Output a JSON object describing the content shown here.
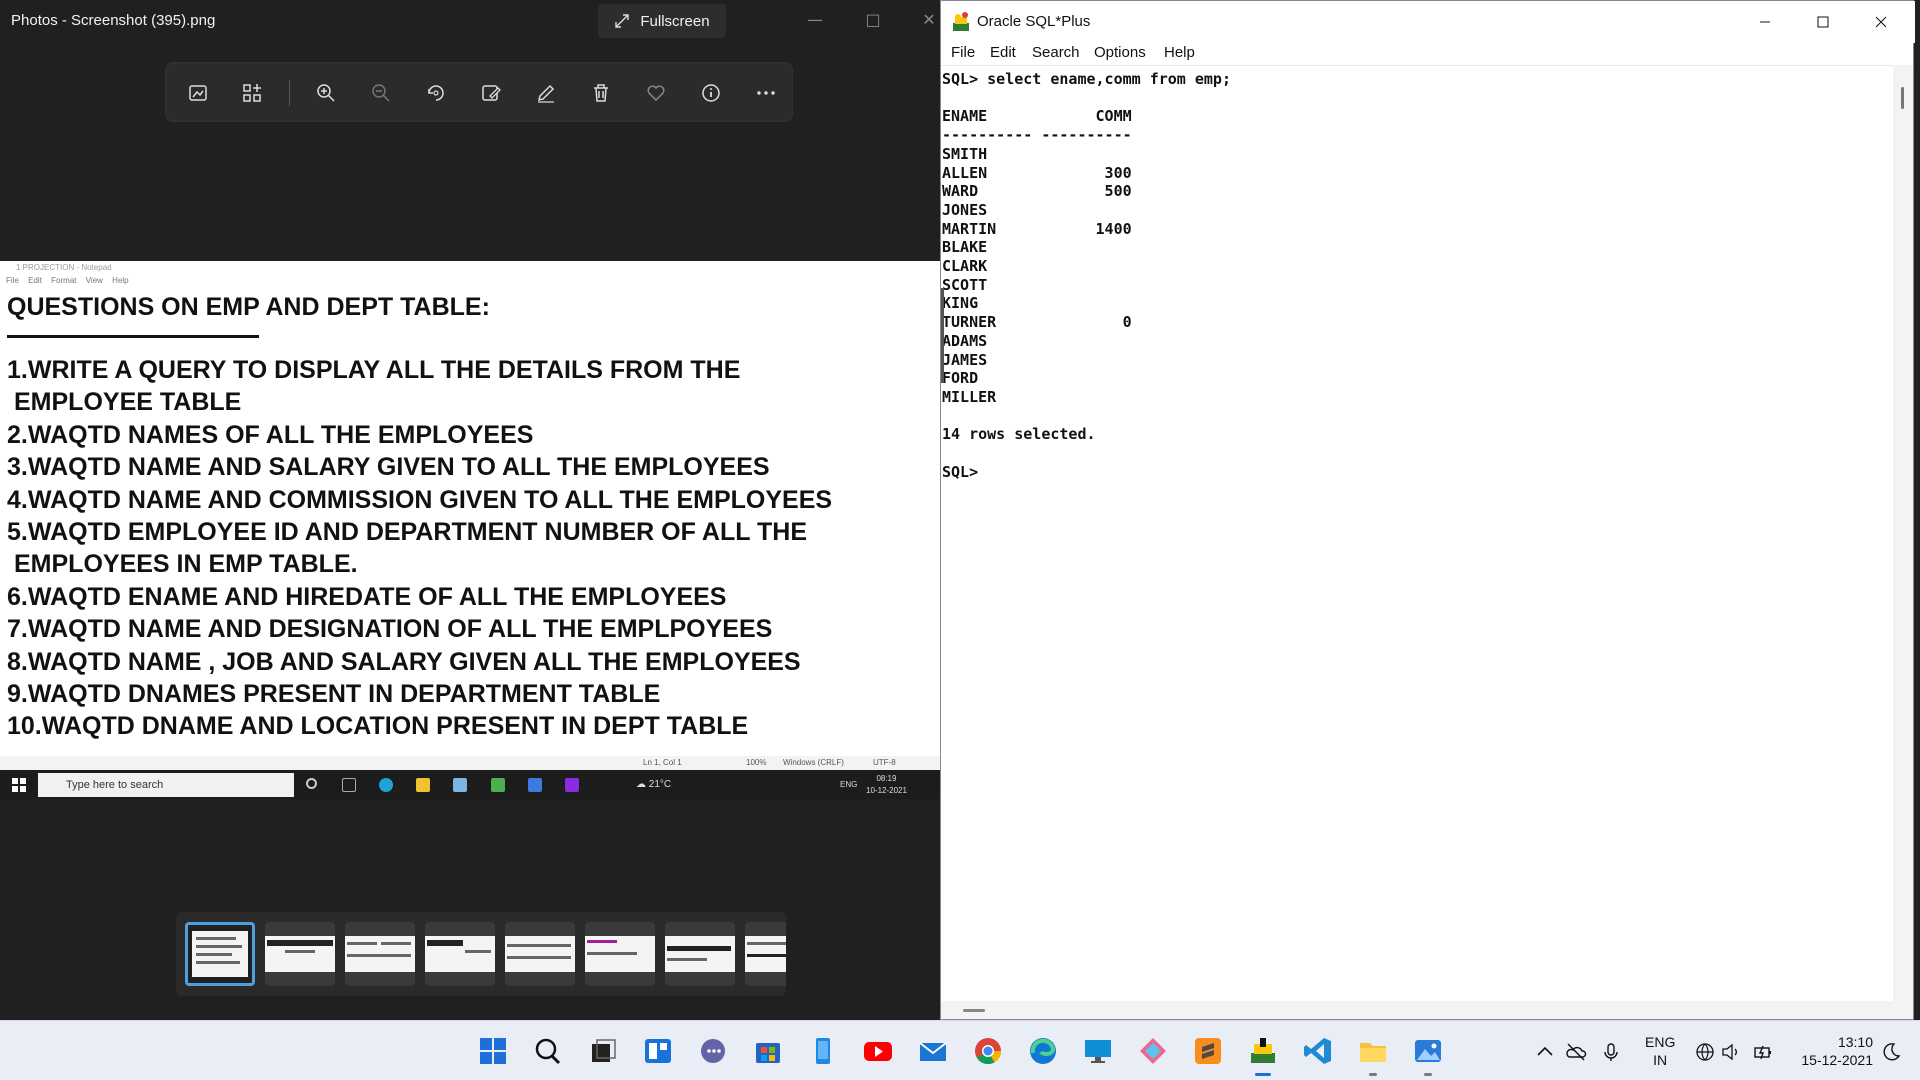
{
  "photos": {
    "title": "Photos - Screenshot (395).png",
    "fullscreen_label": "Fullscreen",
    "toolbar_icons": [
      "enhance-icon",
      "add-to-album-icon",
      "zoom-in-icon",
      "zoom-out-icon",
      "rotate-icon",
      "edit-image-icon",
      "draw-icon",
      "delete-icon",
      "favorite-icon",
      "info-icon",
      "more-icon"
    ]
  },
  "notepad": {
    "title": "1 PROJECTION - Notepad",
    "menu": [
      "File",
      "Edit",
      "Format",
      "View",
      "Help"
    ],
    "heading": "QUESTIONS ON EMP AND DEPT TABLE:",
    "lines": [
      "1.WRITE A QUERY TO DISPLAY ALL THE DETAILS FROM THE",
      " EMPLOYEE TABLE",
      "2.WAQTD NAMES OF ALL THE EMPLOYEES",
      "3.WAQTD NAME AND SALARY GIVEN TO ALL THE EMPLOYEES",
      "4.WAQTD NAME AND COMMISSION GIVEN TO ALL THE EMPLOYEES",
      "5.WAQTD EMPLOYEE ID AND DEPARTMENT NUMBER OF ALL THE",
      " EMPLOYEES IN EMP TABLE.",
      "6.WAQTD ENAME AND HIREDATE OF ALL THE EMPLOYEES",
      "7.WAQTD NAME AND DESIGNATION OF ALL THE EMPLPOYEES",
      "8.WAQTD NAME , JOB AND SALARY GIVEN ALL THE EMPLOYEES",
      "9.WAQTD DNAMES PRESENT IN DEPARTMENT TABLE",
      "10.WAQTD DNAME AND LOCATION PRESENT IN DEPT TABLE"
    ],
    "status": {
      "position": "Ln 1, Col 1",
      "zoom": "100%",
      "line_ending": "Windows (CRLF)",
      "encoding": "UTF-8"
    }
  },
  "mini_taskbar": {
    "search_placeholder": "Type here to search",
    "weather": "21°C",
    "lang": "ENG",
    "time": "08:19",
    "date": "10-12-2021"
  },
  "sqlplus": {
    "title": "Oracle SQL*Plus",
    "menu": [
      "File",
      "Edit",
      "Search",
      "Options",
      "Help"
    ],
    "console_lines": [
      "SQL> select ename,comm from emp;",
      "",
      "ENAME            COMM",
      "---------- ----------",
      "SMITH",
      "ALLEN             300",
      "WARD              500",
      "JONES",
      "MARTIN           1400",
      "BLAKE",
      "CLARK",
      "SCOTT",
      "KING",
      "TURNER              0",
      "ADAMS",
      "JAMES",
      "FORD",
      "MILLER",
      "",
      "14 rows selected.",
      "",
      "SQL>"
    ]
  },
  "taskbar": {
    "apps": [
      "start-icon",
      "search-icon",
      "task-view-icon",
      "widgets-icon",
      "teams-chat-icon",
      "store-icon",
      "phone-icon",
      "youtube-icon",
      "mail-icon",
      "chrome-icon",
      "edge-icon",
      "remote-desktop-icon",
      "snip-icon",
      "sublime-text-icon",
      "oracle-sqlplus-icon",
      "vscode-icon",
      "file-explorer-icon",
      "photos-icon"
    ],
    "lang_top": "ENG",
    "lang_bottom": "IN",
    "time": "13:10",
    "date": "15-12-2021"
  }
}
